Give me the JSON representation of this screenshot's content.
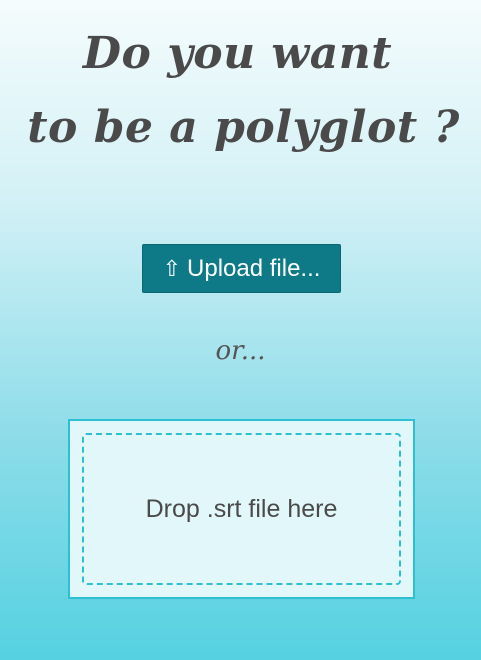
{
  "heading": {
    "line1": "Do you want",
    "line2": "to be a polyglot ?"
  },
  "upload": {
    "icon": "upload-arrow-icon",
    "icon_glyph": "⇧",
    "label": "Upload file..."
  },
  "separator": "or...",
  "dropzone": {
    "label": "Drop .srt file here"
  },
  "colors": {
    "button_bg": "#0e7a87",
    "accent": "#2ebfd2",
    "text": "#4a4a4a"
  }
}
